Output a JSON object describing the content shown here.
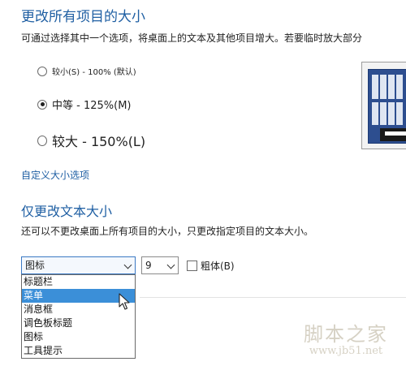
{
  "section1": {
    "title": "更改所有项目的大小",
    "description": "可通过选择其中一个选项，将桌面上的文本及其他项目增大。若要临时放大部分",
    "options": [
      {
        "label": "较小(S) - 100% (默认)",
        "checked": false
      },
      {
        "label": "中等 - 125%(M)",
        "checked": true
      },
      {
        "label": "较大 - 150%(L)",
        "checked": false
      }
    ],
    "custom_link": "自定义大小选项"
  },
  "section2": {
    "title": "仅更改文本大小",
    "description": "还可以不更改桌面上所有项目的大小，只更改指定项目的文本大小。",
    "item_select_value": "图标",
    "size_select_value": "9",
    "bold_label": "粗体(B)",
    "dropdown_items": [
      "标题栏",
      "菜单",
      "消息框",
      "调色板标题",
      "图标",
      "工具提示"
    ],
    "dropdown_selected_index": 1
  },
  "watermark": {
    "line1": "脚本之家",
    "line2": "www.jb51.net"
  },
  "colors": {
    "accent": "#1f5fa3",
    "highlight": "#3b8fd8",
    "preview_bg": "#2d4e8f"
  },
  "icons": [
    "radio-icon",
    "chevron-down-icon",
    "checkbox-icon",
    "mouse-pointer-icon"
  ]
}
